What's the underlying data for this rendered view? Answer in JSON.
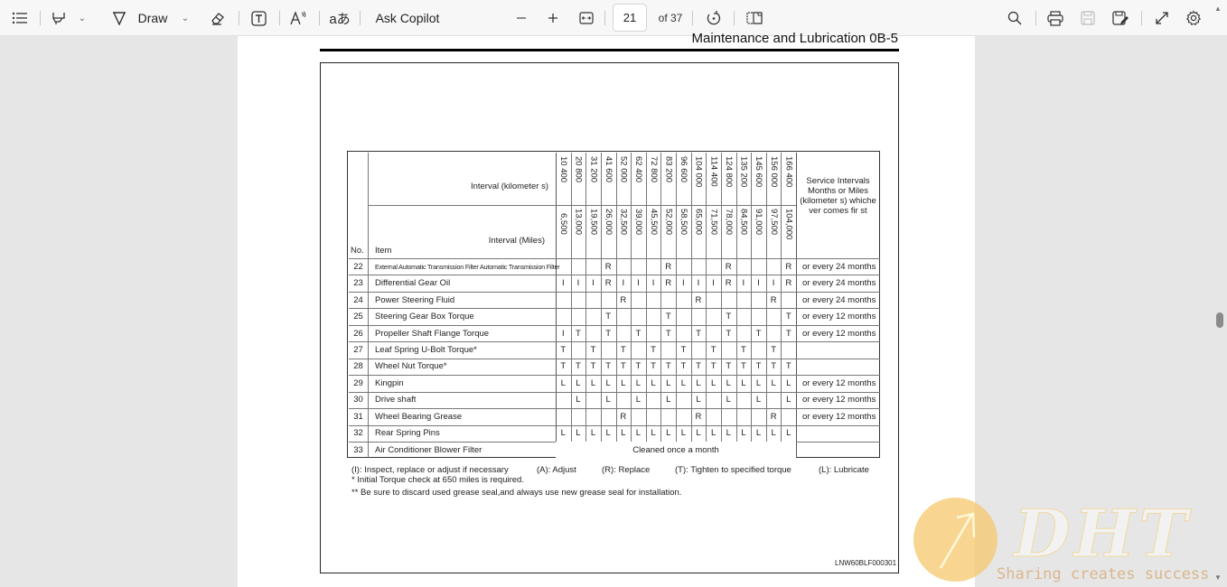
{
  "toolbar": {
    "contents_icon": "table-of-contents-icon",
    "highlight_icon": "highlighter-icon",
    "draw_label": "Draw",
    "erase_icon": "eraser-icon",
    "textbox_icon": "text-box-icon",
    "read_aloud_icon": "read-aloud-icon",
    "translate_icon": "translate-icon",
    "copilot_label": "Ask Copilot",
    "zoom_out_icon": "minus-icon",
    "zoom_in_icon": "plus-icon",
    "fit_icon": "fit-width-icon",
    "page_current": "21",
    "page_total": "of 37",
    "rotate_icon": "rotate-icon",
    "page_view_icon": "page-view-icon",
    "search_icon": "search-icon",
    "print_icon": "print-icon",
    "save_icon": "save-icon",
    "save_as_icon": "save-as-icon",
    "fullscreen_icon": "fullscreen-icon",
    "settings_icon": "settings-icon"
  },
  "document": {
    "header_title": "Maintenance and Lubrication    0B-5",
    "figure_id": "LNW60BLF000301",
    "table": {
      "header_km_label": "Interval (kilometer  s)",
      "header_miles_label": "Interval (Miles)",
      "col_no": "No.",
      "col_item": "Item",
      "service_header": "Service Intervals Months or Miles (kilometer s) whiche ver comes fir st",
      "km": [
        "10 400",
        "20 800",
        "31 200",
        "41 600",
        "52 000",
        "62 400",
        "72 800",
        "83 200",
        "96 600",
        "104 000",
        "114 400",
        "124 800",
        "135 200",
        "145 600",
        "156 000",
        "166 400"
      ],
      "miles": [
        "6,500",
        "13,000",
        "19,500",
        "26,000",
        "32,500",
        "39,000",
        "45,500",
        "52,000",
        "58,500",
        "65,000",
        "71,500",
        "78,000",
        "84,500",
        "91,000",
        "97,500",
        "104,000"
      ],
      "rows": [
        {
          "no": "22",
          "item": "External Automatic Transmission Filter   Automatic Transmission Filter",
          "small": true,
          "cells": [
            "",
            "",
            "",
            "R",
            "",
            "",
            "",
            "R",
            "",
            "",
            "",
            "R",
            "",
            "",
            "",
            "R"
          ],
          "service": "or every 24 months"
        },
        {
          "no": "23",
          "item": "Differential Gear Oil",
          "cells": [
            "I",
            "I",
            "I",
            "R",
            "I",
            "I",
            "I",
            "R",
            "I",
            "I",
            "I",
            "R",
            "I",
            "I",
            "I",
            "R"
          ],
          "service": "or every 24 months"
        },
        {
          "no": "24",
          "item": "Power Steering Fluid",
          "cells": [
            "",
            "",
            "",
            "",
            "R",
            "",
            "",
            "",
            "",
            "R",
            "",
            "",
            "",
            "",
            "R",
            ""
          ],
          "service": "or every 24 months"
        },
        {
          "no": "25",
          "item": "Steering Gear Box Torque",
          "cells": [
            "",
            "",
            "",
            "T",
            "",
            "",
            "",
            "T",
            "",
            "",
            "",
            "T",
            "",
            "",
            "",
            "T"
          ],
          "service": "or every 12 months"
        },
        {
          "no": "26",
          "item": "Propeller Shaft Flange Torque",
          "cells": [
            "I",
            "T",
            "",
            "T",
            "",
            "T",
            "",
            "T",
            "",
            "T",
            "",
            "T",
            "",
            "T",
            "",
            "T"
          ],
          "service": "or every 12 months"
        },
        {
          "no": "27",
          "item": "Leaf Spring U-Bolt Torque*",
          "cells": [
            "T",
            "",
            "T",
            "",
            "T",
            "",
            "T",
            "",
            "T",
            "",
            "T",
            "",
            "T",
            "",
            "T",
            ""
          ],
          "service": ""
        },
        {
          "no": "28",
          "item": "Wheel Nut Torque*",
          "cells": [
            "T",
            "T",
            "T",
            "T",
            "T",
            "T",
            "T",
            "T",
            "T",
            "T",
            "T",
            "T",
            "T",
            "T",
            "T",
            "T"
          ],
          "service": ""
        },
        {
          "no": "29",
          "item": "Kingpin",
          "cells": [
            "L",
            "L",
            "L",
            "L",
            "L",
            "L",
            "L",
            "L",
            "L",
            "L",
            "L",
            "L",
            "L",
            "L",
            "L",
            "L"
          ],
          "service": "or every 12 months"
        },
        {
          "no": "30",
          "item": "Drive shaft",
          "cells": [
            "",
            "L",
            "",
            "L",
            "",
            "L",
            "",
            "L",
            "",
            "L",
            "",
            "L",
            "",
            "L",
            "",
            "L"
          ],
          "service": "or every 12 months"
        },
        {
          "no": "31",
          "item": "Wheel Bearing Grease",
          "cells": [
            "",
            "",
            "",
            "",
            "R",
            "",
            "",
            "",
            "",
            "R",
            "",
            "",
            "",
            "",
            "R",
            ""
          ],
          "service": "or every 12 months"
        },
        {
          "no": "32",
          "item": "Rear Spring Pins",
          "cells": [
            "L",
            "L",
            "L",
            "L",
            "L",
            "L",
            "L",
            "L",
            "L",
            "L",
            "L",
            "L",
            "L",
            "L",
            "L",
            "L"
          ],
          "service": ""
        },
        {
          "no": "33",
          "item": " Air Conditioner Blower Filter",
          "merged": "Cleaned once a month",
          "service": ""
        }
      ]
    },
    "legend": {
      "inspect": "(I): Inspect, replace or adjust if necessary",
      "adjust": "(A): Adjust",
      "replace": "(R): Replace",
      "tighten": "(T): Tighten to specified torque",
      "lubricate": "(L): Lubricate",
      "note1": "* Initial Torque check at 650 miles is required.",
      "note2": "** Be sure to discard used grease seal,and always use new grease seal for installation."
    }
  },
  "watermark": {
    "logo_text": "DHT",
    "slogan": "Sharing creates success"
  }
}
